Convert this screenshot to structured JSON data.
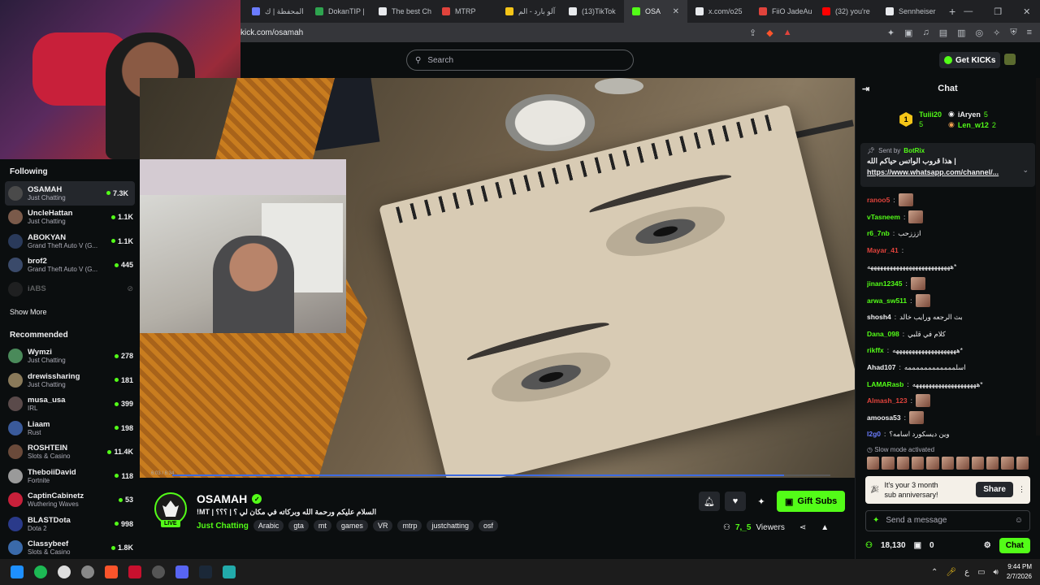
{
  "browser": {
    "tabs": [
      {
        "label": "المحفظة | ك",
        "color": "#6b7cff"
      },
      {
        "label": "DokanTIP |",
        "color": "#2ea44f"
      },
      {
        "label": "The best Ch",
        "color": "#e8eaed"
      },
      {
        "label": "MTRP",
        "color": "#e0433c"
      },
      {
        "label": "آلو بارد - الم",
        "color": "#f5c518"
      },
      {
        "label": "(13)TikTok",
        "color": "#e8eaed"
      },
      {
        "label": "OSA",
        "color": "#53fc18"
      },
      {
        "label": "x.com/o25",
        "color": "#e8eaed"
      },
      {
        "label": "FiiO JadeAu",
        "color": "#e0433c"
      },
      {
        "label": "(32) you're",
        "color": "#ff0000"
      },
      {
        "label": "Sennheiser",
        "color": "#e8eaed"
      }
    ],
    "url": "kick.com/osamah"
  },
  "topnav": {
    "search_placeholder": "Search",
    "get_kicks": "Get KICKs"
  },
  "sidebar": {
    "following_heading": "Following",
    "following": [
      {
        "name": "OSAMAH",
        "category": "Just Chatting",
        "viewers": "7.3K",
        "color": "#4a4a4a"
      },
      {
        "name": "UncleHattan",
        "category": "Just Chatting",
        "viewers": "1.1K",
        "color": "#7a5a4a"
      },
      {
        "name": "ABOKYAN",
        "category": "Grand Theft Auto V (G...",
        "viewers": "1.1K",
        "color": "#2a3a5a"
      },
      {
        "name": "brof2",
        "category": "Grand Theft Auto V (G...",
        "viewers": "445",
        "color": "#3a4a6a"
      }
    ],
    "offline": {
      "name": "iABS"
    },
    "show_more": "Show More",
    "recommended_heading": "Recommended",
    "recommended": [
      {
        "name": "Wymzi",
        "category": "Just Chatting",
        "viewers": "278",
        "color": "#4a8a5a"
      },
      {
        "name": "drewissharing",
        "category": "Just Chatting",
        "viewers": "181",
        "color": "#8a7a5a"
      },
      {
        "name": "musa_usa",
        "category": "IRL",
        "viewers": "399",
        "color": "#5a4a4a"
      },
      {
        "name": "Liaam",
        "category": "Rust",
        "viewers": "198",
        "color": "#3a5a9a"
      },
      {
        "name": "ROSHTEIN",
        "category": "Slots & Casino",
        "viewers": "11.4K",
        "color": "#6a4a3a"
      },
      {
        "name": "TheboiiDavid",
        "category": "Fortnite",
        "viewers": "118",
        "color": "#9a9a9a"
      },
      {
        "name": "CaptinCabinetz",
        "category": "Wuthering Waves",
        "viewers": "53",
        "color": "#c8203a"
      },
      {
        "name": "BLASTDota",
        "category": "Dota 2",
        "viewers": "998",
        "color": "#2a3a8a"
      },
      {
        "name": "Classybeef",
        "category": "Slots & Casino",
        "viewers": "1.8K",
        "color": "#3a6aaa"
      }
    ]
  },
  "player": {
    "time": "6:03 / 6:34",
    "progress": 0.93
  },
  "channel": {
    "name": "OSAMAH",
    "live": "LIVE",
    "title": "!MT | السلام عليكم ورحمة الله وبركاته في مكان لي ؟ | ؟؟؟",
    "category": "Just Chatting",
    "tags": [
      "Arabic",
      "gta",
      "mt",
      "games",
      "VR",
      "mtrp",
      "justchatting",
      "osf"
    ],
    "gift_label": "Gift Subs",
    "viewers": "7,_5",
    "viewers_label": "Viewers"
  },
  "chat": {
    "title": "Chat",
    "leaderboard": {
      "rank": "1",
      "first": {
        "name": "Tuiii20",
        "value": "5"
      },
      "second": {
        "name": "iAryen",
        "value": "5"
      },
      "third": {
        "name": "Len_w12",
        "value": "2"
      }
    },
    "pinned": {
      "sent_by": "Sent by",
      "bot": "BotRix",
      "text": "هذا قروب الواتس حياكم الله |",
      "link": "https://www.whatsapp.com/channel/..."
    },
    "messages": [
      {
        "user": "ranoo5",
        "color": "#e0433c",
        "text": "",
        "emote": true
      },
      {
        "user": "vTasneem",
        "color": "#53fc18",
        "text": "",
        "emote": true
      },
      {
        "user": "r6_7nb",
        "color": "#53fc18",
        "text": "ازززحب",
        "emote": false
      },
      {
        "user": "Mayar_41",
        "color": "#e0433c",
        "text": "",
        "emote": false
      },
      {
        "user": "",
        "color": "#efeff1",
        "text": "ههههههههههههههههههههههههههه*",
        "emote": false
      },
      {
        "user": "jinan12345",
        "color": "#53fc18",
        "text": "",
        "emote": true
      },
      {
        "user": "arwa_sw511",
        "color": "#53fc18",
        "text": "",
        "emote": true
      },
      {
        "user": "shosh4",
        "color": "#efeff1",
        "text": "بث الرجعه ورايب خالد",
        "emote": false
      },
      {
        "user": "Dana_098",
        "color": "#53fc18",
        "text": "كلام في قلبي",
        "emote": false
      },
      {
        "user": "rikffx",
        "color": "#53fc18",
        "text": "ههههههههههههههههههههه*",
        "emote": false
      },
      {
        "user": "Ahad107",
        "color": "#efeff1",
        "text": "اسلممممممممممممه",
        "emote": false
      },
      {
        "user": "LAMARasb",
        "color": "#53fc18",
        "text": "ههههههههههههههههههههه*",
        "emote": false
      },
      {
        "user": "Almash_123",
        "color": "#e0433c",
        "text": "",
        "emote": true
      },
      {
        "user": "amoosa53",
        "color": "#efeff1",
        "text": "",
        "emote": true
      },
      {
        "user": "l2g0",
        "color": "#6b7cff",
        "text": "وين ديسكورد اسامه؟",
        "emote": false
      }
    ],
    "slow_mode": "Slow mode activated",
    "anniversary": {
      "line1": "It's your 3 month",
      "line2": "sub anniversary!",
      "share": "Share"
    },
    "input_placeholder": "Send a message",
    "points": "18,130",
    "count": "0",
    "chat_button": "Chat"
  },
  "taskbar": {
    "lang": "ع",
    "time": "9:44 PM",
    "date": "2/7/2026"
  }
}
